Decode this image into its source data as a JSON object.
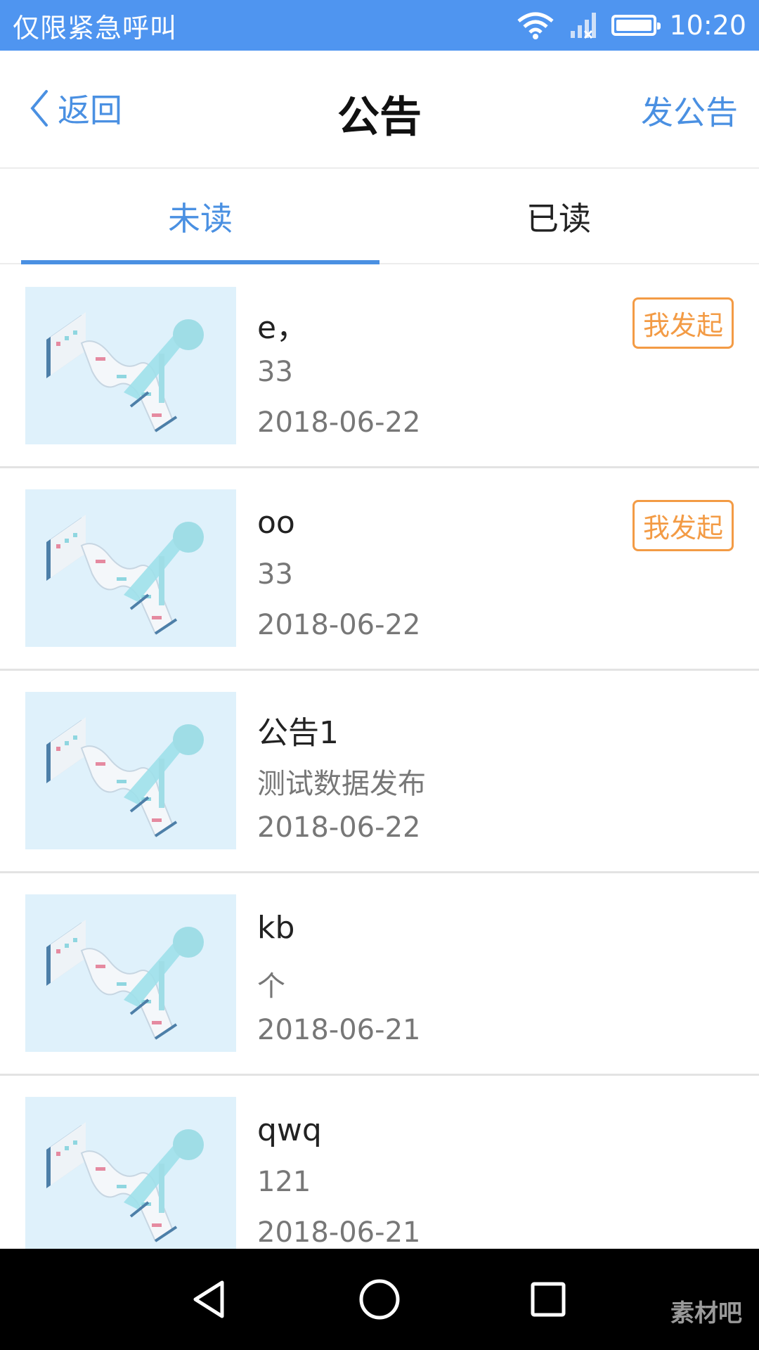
{
  "status_bar": {
    "carrier_text": "仅限紧急呼叫",
    "time": "10:20",
    "icons": [
      "wifi-icon",
      "signal-icon",
      "battery-icon"
    ]
  },
  "header": {
    "back_label": "返回",
    "title": "公告",
    "action_label": "发公告"
  },
  "tabs": [
    {
      "label": "未读",
      "active": true
    },
    {
      "label": "已读",
      "active": false
    }
  ],
  "items": [
    {
      "title": "e，",
      "desc": "33",
      "date": "2018-06-22",
      "badge": "我发起"
    },
    {
      "title": "oo",
      "desc": "33",
      "date": "2018-06-22",
      "badge": "我发起"
    },
    {
      "title": "公告1",
      "desc": "测试数据发布",
      "date": "2018-06-22",
      "badge": ""
    },
    {
      "title": "kb",
      "desc": "个",
      "date": "2018-06-21",
      "badge": ""
    },
    {
      "title": "qwq",
      "desc": "121",
      "date": "2018-06-21",
      "badge": ""
    }
  ],
  "watermark": "素材吧",
  "colors": {
    "accent": "#4a90e2",
    "status_bar": "#4f95f0",
    "badge": "#f39b45",
    "thumb_bg": "#dff1fb"
  }
}
